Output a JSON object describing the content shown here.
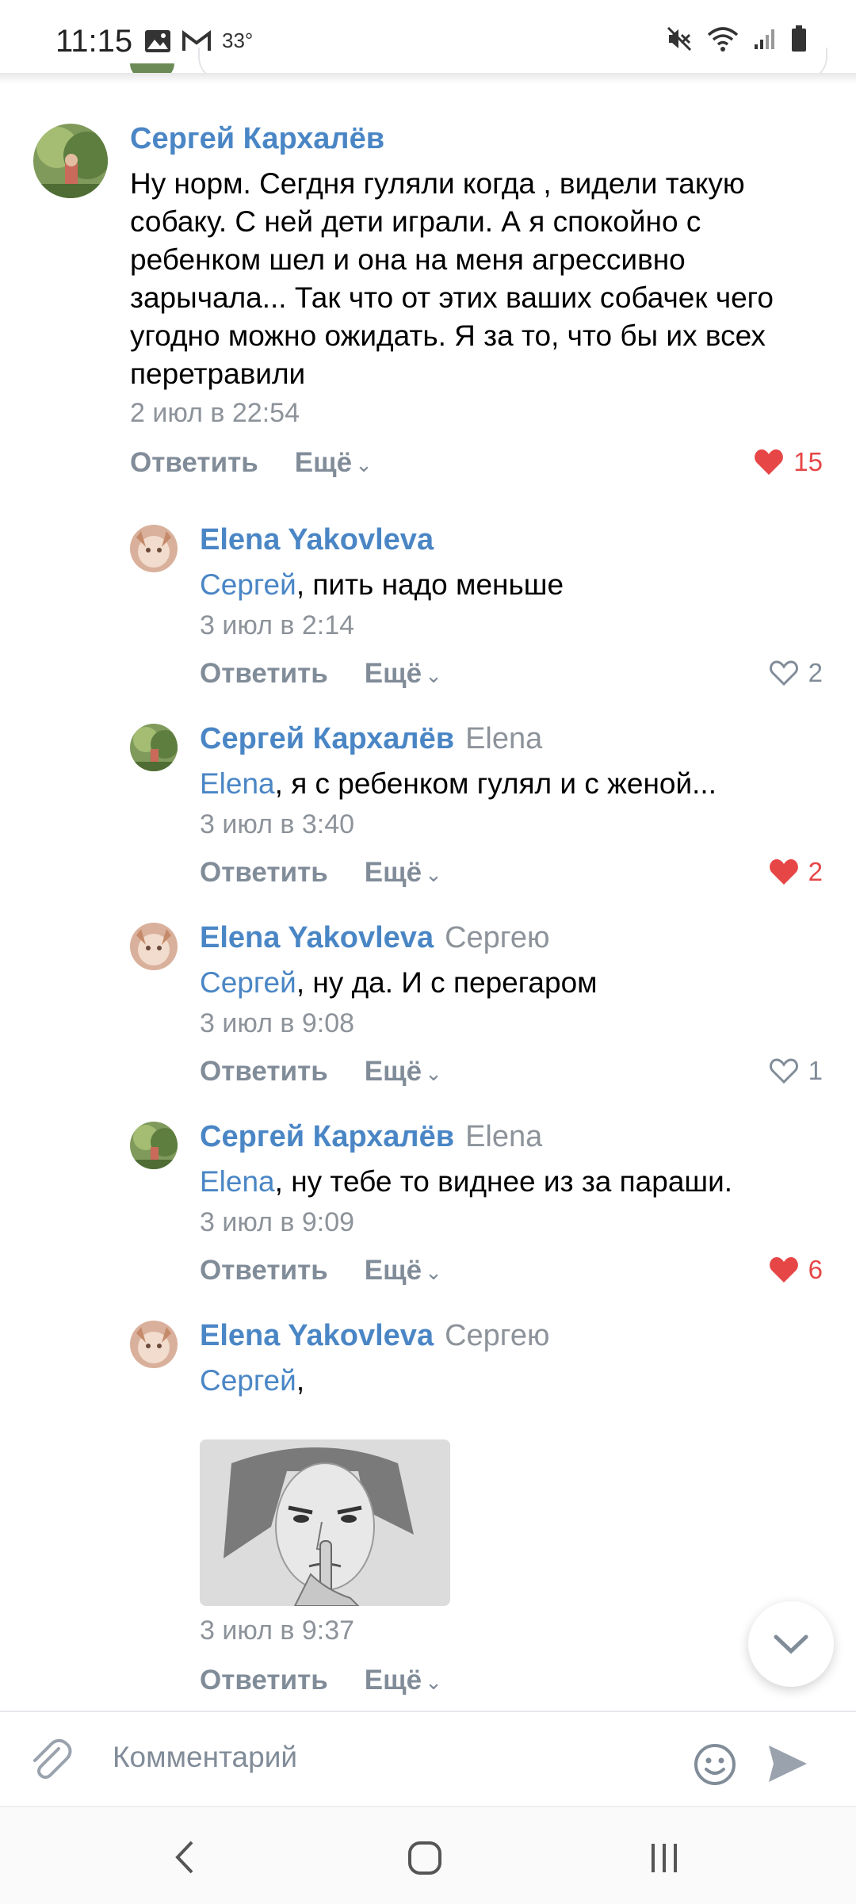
{
  "status_bar": {
    "time": "11:15",
    "temperature": "33°",
    "icons": [
      "image-icon",
      "gmail-icon",
      "mute-icon",
      "wifi-icon",
      "signal-icon",
      "battery-icon"
    ]
  },
  "comments": [
    {
      "author": "Сергей Кархалёв",
      "reply_to": "",
      "text": "Ну норм. Сегдня гуляли когда , видели такую собаку. С ней дети играли. А я спокойно с ребенком шел и она на меня агрессивно зарычала... Так что от этих ваших собачек чего угодно можно ожидать. Я за то, что бы их всех перетравили",
      "time": "2 июл в 22:54",
      "reply_label": "Ответить",
      "more_label": "Ещё",
      "likes": "15",
      "liked": true
    },
    {
      "author": "Elena Yakovleva",
      "reply_to": "",
      "mention": "Сергей",
      "text": ", пить надо меньше",
      "time": "3 июл в 2:14",
      "reply_label": "Ответить",
      "more_label": "Ещё",
      "likes": "2",
      "liked": false
    },
    {
      "author": "Сергей Кархалёв",
      "reply_to": "Elena",
      "mention": "Elena",
      "text": ", я с ребенком гулял и с женой...",
      "time": "3 июл в 3:40",
      "reply_label": "Ответить",
      "more_label": "Ещё",
      "likes": "2",
      "liked": true
    },
    {
      "author": "Elena Yakovleva",
      "reply_to": "Сергею",
      "mention": "Сергей",
      "text": ", ну да. И с перегаром",
      "time": "3 июл в 9:08",
      "reply_label": "Ответить",
      "more_label": "Ещё",
      "likes": "1",
      "liked": false
    },
    {
      "author": "Сергей Кархалёв",
      "reply_to": "Elena",
      "mention": "Elena",
      "text": ", ну тебе то виднее из за параши.",
      "time": "3 июл в 9:09",
      "reply_label": "Ответить",
      "more_label": "Ещё",
      "likes": "6",
      "liked": true
    },
    {
      "author": "Elena Yakovleva",
      "reply_to": "Сергею",
      "mention": "Сергей",
      "text": ",",
      "time": "3 июл в 9:37",
      "reply_label": "Ответить",
      "more_label": "Ещё",
      "has_image": true
    }
  ],
  "composer": {
    "placeholder": "Комментарий"
  },
  "colors": {
    "link": "#4a86c5",
    "like_active": "#e64646",
    "muted": "#818c99"
  }
}
